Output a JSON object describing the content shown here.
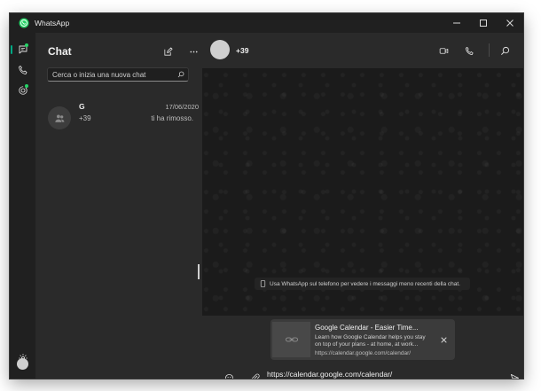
{
  "window": {
    "title": "WhatsApp",
    "controls": [
      "minimize-icon",
      "maximize-icon",
      "close-icon"
    ]
  },
  "colors": {
    "accent": "#00a884",
    "background": "#202020",
    "panel": "#2a2a2a",
    "conversation": "#1b1b1b"
  },
  "rail": {
    "items": [
      {
        "icon": "chats-icon",
        "active": true
      },
      {
        "icon": "phone-icon"
      },
      {
        "icon": "status-icon"
      }
    ],
    "bottom": [
      {
        "icon": "gear-icon"
      },
      {
        "icon": "profile-avatar"
      }
    ]
  },
  "chatlist": {
    "title": "Chat",
    "new_chat_icon": "compose-icon",
    "more_icon": "more-icon",
    "search_placeholder": "Cerca o inizia una nuova chat",
    "chats": [
      {
        "name": "G",
        "date": "17/06/2020",
        "sender": "+39",
        "preview": "ti ha rimosso."
      }
    ]
  },
  "conversation": {
    "contact": "+39",
    "header_icons": [
      "video-icon",
      "phone-icon",
      "search-icon"
    ],
    "notice": "Usa WhatsApp sul telefono per vedere i messaggi meno recenti della chat.",
    "link_preview": {
      "title": "Google Calendar - Easier Time...",
      "description": "Learn how Google Calendar helps you stay on top of your plans - at home, at work...",
      "url": "https://calendar.google.com/calendar/"
    },
    "input_value": "https://calendar.google.com/calendar/"
  }
}
